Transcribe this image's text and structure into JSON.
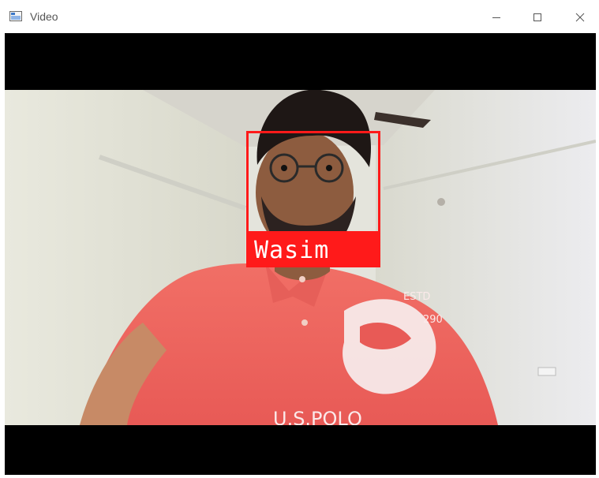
{
  "window": {
    "title": "Video",
    "icon": "window-app-icon",
    "controls": [
      "minimize-icon",
      "maximize-icon",
      "close-icon"
    ]
  },
  "video": {
    "detected_name": "Wasim",
    "box_color": "#ff1a1a"
  }
}
